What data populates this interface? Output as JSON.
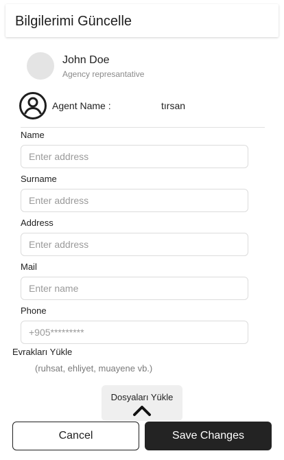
{
  "header": {
    "title": "Bilgilerimi Güncelle"
  },
  "user": {
    "name": "John Doe",
    "role": "Agency represantative"
  },
  "agent": {
    "label": "Agent Name :",
    "value": "tırsan"
  },
  "form": {
    "name": {
      "label": "Name",
      "placeholder": "Enter address"
    },
    "surname": {
      "label": "Surname",
      "placeholder": "Enter address"
    },
    "address": {
      "label": "Address",
      "placeholder": "Enter address"
    },
    "mail": {
      "label": "Mail",
      "placeholder": "Enter name"
    },
    "phone": {
      "label": "Phone",
      "placeholder": "+905*********"
    }
  },
  "documents": {
    "title": "Evrakları Yükle",
    "hint": "(ruhsat, ehliyet, muayene vb.)",
    "upload_label": "Dosyaları Yükle"
  },
  "actions": {
    "cancel_label": "Cancel",
    "save_label": "Save Changes"
  },
  "icons": {
    "agent": "user-circle-icon",
    "upload": "chevron-up-icon"
  }
}
